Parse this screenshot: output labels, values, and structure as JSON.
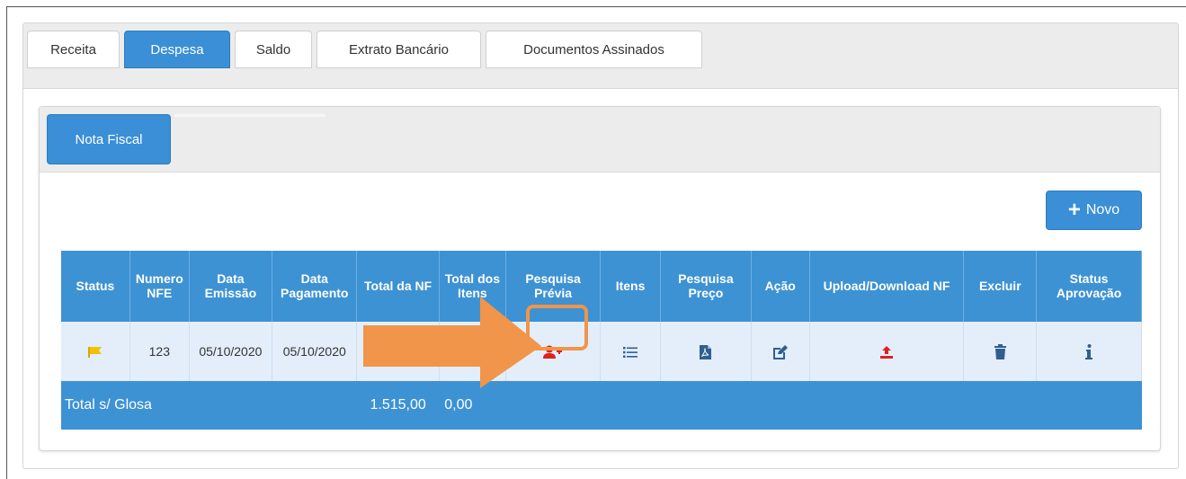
{
  "tabs": [
    "Receita",
    "Despesa",
    "Saldo",
    "Extrato Bancário",
    "Documentos Assinados"
  ],
  "active_tab": "Despesa",
  "subtab": {
    "label": "Nota Fiscal"
  },
  "novo_button": {
    "label": "Novo"
  },
  "table": {
    "headers": [
      "Status",
      "Numero NFE",
      "Data Emissão",
      "Data Pagamento",
      "Total da NF",
      "Total dos Itens",
      "Pesquisa Prévia",
      "Itens",
      "Pesquisa Preço",
      "Ação",
      "Upload/Download NF",
      "Excluir",
      "Status Aprovação"
    ],
    "rows": [
      {
        "numero_nfe": "123",
        "data_emissao": "05/10/2020",
        "data_pagamento": "05/10/2020"
      }
    ],
    "total": {
      "label": "Total s/ Glosa",
      "total_nf": "1.515,00",
      "total_itens": "0,00"
    }
  },
  "icons": {
    "status": "flag-icon",
    "pesquisa_previa": "user-plus-icon",
    "itens": "list-icon",
    "pesquisa_preco": "pdf-file-icon",
    "acao": "edit-icon",
    "upload_download": "upload-icon",
    "excluir": "trash-icon",
    "status_aprovacao": "info-icon"
  },
  "colors": {
    "primary": "#3a8fd6",
    "header_bg": "#3d92d4",
    "row_bg": "#e3eefa",
    "flag": "#f2c200",
    "accent_red": "#e01f1f",
    "icon_blue": "#2f5f8f",
    "annotation": "#f0954a"
  }
}
